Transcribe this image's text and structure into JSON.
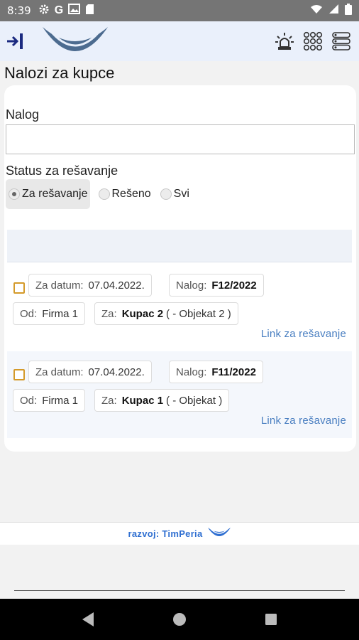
{
  "status_bar": {
    "time": "8:39",
    "icons_left": [
      "gear-icon",
      "google-icon",
      "image-icon",
      "sd-card-icon"
    ],
    "icons_right": [
      "wifi-icon",
      "signal-icon",
      "battery-icon"
    ]
  },
  "app_header": {
    "menu_icon": "collapse-sidebar-icon",
    "logo": "timperia-logo",
    "actions": [
      "alarm-light-icon",
      "grid-dots-icon",
      "list-layout-icon"
    ]
  },
  "page": {
    "title": "Nalozi za kupce"
  },
  "filters": {
    "nalog_label": "Nalog",
    "nalog_value": "",
    "nalog_placeholder": "",
    "status_label": "Status za rešavanje",
    "status_options": [
      {
        "label": "Za rešavanje",
        "selected": true
      },
      {
        "label": "Rešeno",
        "selected": false
      },
      {
        "label": "Svi",
        "selected": false
      }
    ]
  },
  "orders": [
    {
      "date_label": "Za datum:",
      "date": "07.04.2022.",
      "nalog_label": "Nalog:",
      "nalog": "F12/2022",
      "from_label": "Od:",
      "from": "Firma 1",
      "to_label": "Za:",
      "customer": "Kupac 2",
      "object": "( - Objekat 2 )",
      "link": "Link za rešavanje"
    },
    {
      "date_label": "Za datum:",
      "date": "07.04.2022.",
      "nalog_label": "Nalog:",
      "nalog": "F11/2022",
      "from_label": "Od:",
      "from": "Firma 1",
      "to_label": "Za:",
      "customer": "Kupac 1",
      "object": "( - Objekat )",
      "link": "Link za rešavanje"
    }
  ],
  "footer": {
    "text": "razvoj: TimPeria"
  },
  "colors": {
    "header_bg": "#eaf0fb",
    "link": "#4a7fc1",
    "checkbox_border": "#d49a2a",
    "footer_text": "#2f6fd1"
  }
}
